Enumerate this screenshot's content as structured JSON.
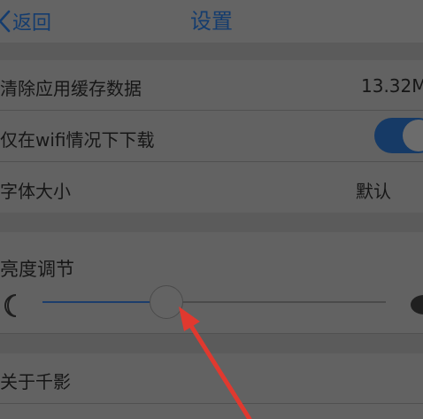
{
  "nav": {
    "back_label": "返回",
    "title": "设置"
  },
  "settings": {
    "clear_cache_label": "清除应用缓存数据",
    "cache_size": "13.32M",
    "wifi_download_label": "仅在wifi情况下下载",
    "wifi_download_on": true,
    "font_size_label": "字体大小",
    "font_size_value": "默认",
    "brightness_label": "亮度调节",
    "brightness_level": 0.36,
    "about_label": "关于千影"
  },
  "colors": {
    "accent": "#143c6e",
    "annotation": "#e0392f"
  }
}
